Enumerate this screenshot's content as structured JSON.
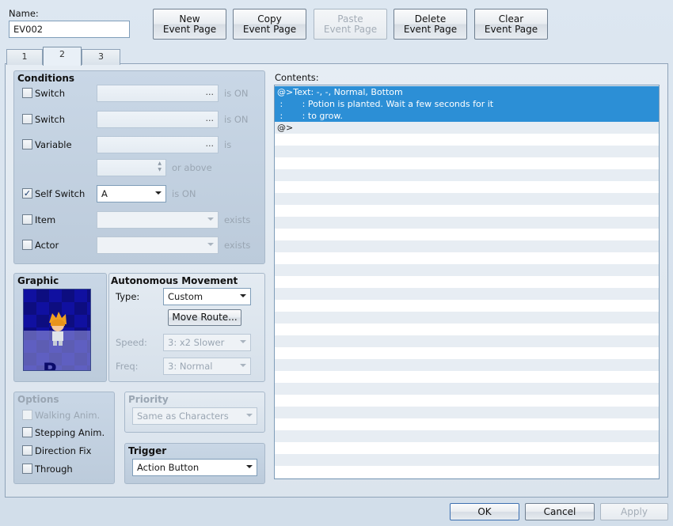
{
  "name": {
    "label": "Name:",
    "value": "EV002"
  },
  "toolbar": {
    "new_page": [
      "New",
      "Event Page"
    ],
    "copy_page": [
      "Copy",
      "Event Page"
    ],
    "paste_page": [
      "Paste",
      "Event Page"
    ],
    "delete_page": [
      "Delete",
      "Event Page"
    ],
    "clear_page": [
      "Clear",
      "Event Page"
    ]
  },
  "tabs": [
    "1",
    "2",
    "3"
  ],
  "active_tab": "2",
  "conditions": {
    "title": "Conditions",
    "switch1": {
      "label": "Switch",
      "suffix": "is ON",
      "dots": "..."
    },
    "switch2": {
      "label": "Switch",
      "suffix": "is ON",
      "dots": "..."
    },
    "variable": {
      "label": "Variable",
      "suffix": "is",
      "dots": "...",
      "or_above": "or above"
    },
    "self_switch": {
      "label": "Self Switch",
      "value": "A",
      "suffix": "is ON",
      "checked": true
    },
    "item": {
      "label": "Item",
      "suffix": "exists"
    },
    "actor": {
      "label": "Actor",
      "suffix": "exists"
    }
  },
  "graphic": {
    "title": "Graphic"
  },
  "movement": {
    "title": "Autonomous Movement",
    "type_label": "Type:",
    "type_value": "Custom",
    "move_route": "Move Route...",
    "speed_label": "Speed:",
    "speed_value": "3: x2 Slower",
    "freq_label": "Freq:",
    "freq_value": "3: Normal"
  },
  "options": {
    "title": "Options",
    "walking": "Walking Anim.",
    "stepping": "Stepping Anim.",
    "direction": "Direction Fix",
    "through": "Through"
  },
  "priority": {
    "title": "Priority",
    "value": "Same as Characters"
  },
  "trigger": {
    "title": "Trigger",
    "value": "Action Button"
  },
  "contents": {
    "label": "Contents:",
    "lines": [
      "@>Text: -, -, Normal, Bottom",
      " :       : Potion is planted. Wait a few seconds for it",
      " :       : to grow.",
      "@>"
    ]
  },
  "footer": {
    "ok": "OK",
    "cancel": "Cancel",
    "apply": "Apply"
  },
  "colors": {
    "selection": "#2c8fd6",
    "panel": "#c9d7e6"
  }
}
